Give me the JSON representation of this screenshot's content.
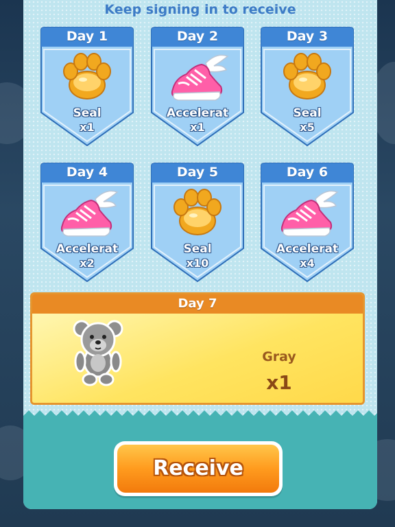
{
  "title": "Keep signing in to receive",
  "days": [
    {
      "day": "Day 1",
      "name": "Seal",
      "qty": "x1",
      "icon": "paw-icon"
    },
    {
      "day": "Day 2",
      "name": "Accelerat",
      "qty": "x1",
      "icon": "winged-shoe-icon"
    },
    {
      "day": "Day 3",
      "name": "Seal",
      "qty": "x5",
      "icon": "paw-icon"
    },
    {
      "day": "Day 4",
      "name": "Accelerat",
      "qty": "x2",
      "icon": "winged-shoe-icon"
    },
    {
      "day": "Day 5",
      "name": "Seal",
      "qty": "x10",
      "icon": "paw-icon"
    },
    {
      "day": "Day 6",
      "name": "Accelerat",
      "qty": "x4",
      "icon": "winged-shoe-icon"
    }
  ],
  "day7": {
    "day": "Day 7",
    "name": "Gray",
    "qty": "x1",
    "icon": "teddy-bear-icon"
  },
  "receive_label": "Receive",
  "colors": {
    "card_header": "#3f86d6",
    "card_body": "#9fd0f5",
    "day7_header": "#e98a24",
    "day7_body": "#ffe35a",
    "button": "#ff9b1e",
    "bottom": "#46b3b4"
  }
}
